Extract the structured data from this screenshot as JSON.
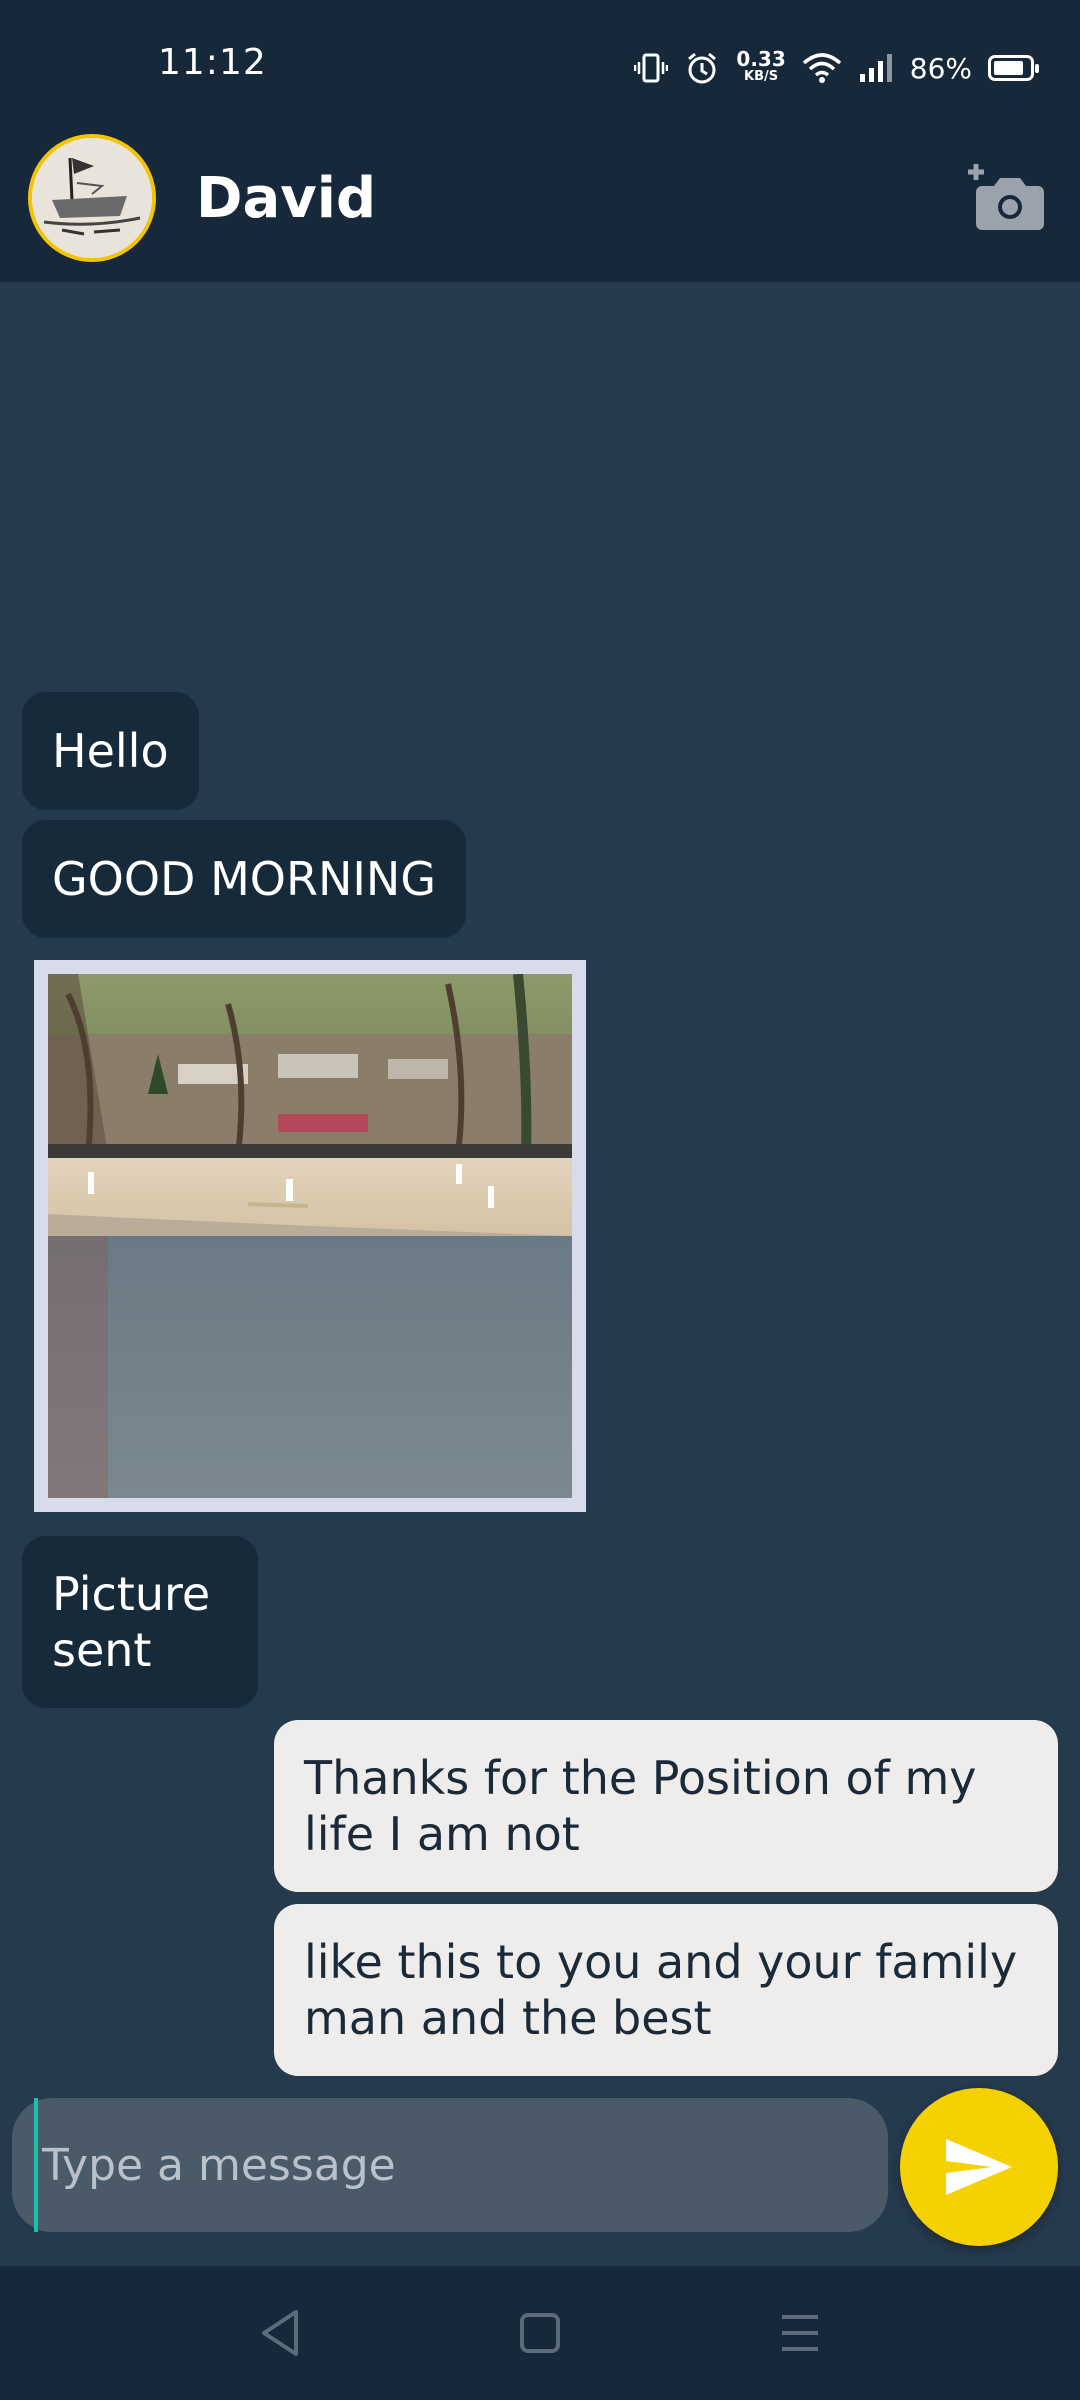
{
  "status_bar": {
    "time": "11:12",
    "net_speed_value": "0.33",
    "net_speed_unit": "KB/S",
    "battery_percent": "86%",
    "battery_level": 0.86
  },
  "header": {
    "contact_name": "David",
    "camera_icon": "add-photo-camera-icon"
  },
  "messages": [
    {
      "direction": "incoming",
      "type": "text",
      "text": "Hello"
    },
    {
      "direction": "incoming",
      "type": "text",
      "text": "GOOD MORNING"
    },
    {
      "direction": "incoming",
      "type": "image"
    },
    {
      "direction": "incoming",
      "type": "text",
      "text": "Picture sent"
    },
    {
      "direction": "outgoing",
      "type": "text",
      "text": "Thanks for the Position of my life I am not"
    },
    {
      "direction": "outgoing",
      "type": "text",
      "text": "like this to you and your family man and the best"
    }
  ],
  "composer": {
    "placeholder": "Type a message",
    "value": ""
  },
  "colors": {
    "background": "#263a4d",
    "bars": "#16283a",
    "incoming_bubble": "#172a3a",
    "outgoing_bubble": "#efedec",
    "accent": "#f6d100"
  }
}
